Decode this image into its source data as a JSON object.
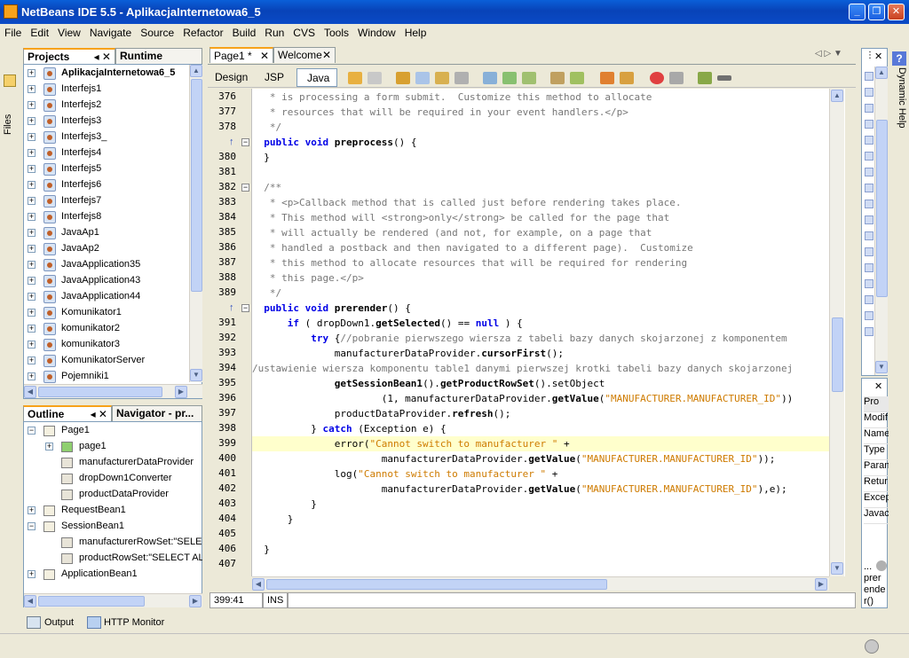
{
  "window": {
    "title": "NetBeans IDE 5.5 - AplikacjaInternetowa6_5"
  },
  "menu": [
    "File",
    "Edit",
    "View",
    "Navigate",
    "Source",
    "Refactor",
    "Build",
    "Run",
    "CVS",
    "Tools",
    "Window",
    "Help"
  ],
  "left_strip": {
    "files_label": "Files"
  },
  "projects_panel": {
    "tabs": [
      "Projects",
      "Runtime"
    ],
    "items": [
      "AplikacjaInternetowa6_5",
      "Interfejs1",
      "Interfejs2",
      "Interfejs3",
      "Interfejs3_",
      "Interfejs4",
      "Interfejs5",
      "Interfejs6",
      "Interfejs7",
      "Interfejs8",
      "JavaAp1",
      "JavaAp2",
      "JavaApplication35",
      "JavaApplication43",
      "JavaApplication44",
      "Komunikator1",
      "komunikator2",
      "komunikator3",
      "KomunikatorServer",
      "Pojemniki1"
    ]
  },
  "outline_panel": {
    "tabs": [
      "Outline",
      "Navigator - pr..."
    ],
    "items": [
      {
        "label": "Page1",
        "level": 0
      },
      {
        "label": "page1",
        "level": 1
      },
      {
        "label": "manufacturerDataProvider",
        "level": 1
      },
      {
        "label": "dropDown1Converter",
        "level": 1
      },
      {
        "label": "productDataProvider",
        "level": 1
      },
      {
        "label": "RequestBean1",
        "level": 0
      },
      {
        "label": "SessionBean1",
        "level": 0
      },
      {
        "label": "manufacturerRowSet:\"SELEC",
        "level": 1
      },
      {
        "label": "productRowSet:\"SELECT ALL",
        "level": 1
      },
      {
        "label": "ApplicationBean1",
        "level": 0
      }
    ]
  },
  "editor_tabs": [
    "Page1 *",
    "Welcome"
  ],
  "view_tabs": [
    "Design",
    "JSP",
    "Java"
  ],
  "code": {
    "lines": [
      {
        "n": "376",
        "t": "   * is processing a form submit.  Customize this method to allocate",
        "c": "cm"
      },
      {
        "n": "377",
        "t": "   * resources that will be required in your event handlers.</p>",
        "c": "cm"
      },
      {
        "n": "378",
        "t": "   */",
        "c": "cm"
      },
      {
        "n": "",
        "t": "  public void preprocess() {",
        "c": "pre"
      },
      {
        "n": "380",
        "t": "  }",
        "c": ""
      },
      {
        "n": "381",
        "t": "",
        "c": ""
      },
      {
        "n": "382",
        "t": "  /**",
        "c": "cm"
      },
      {
        "n": "383",
        "t": "   * <p>Callback method that is called just before rendering takes place.",
        "c": "cm"
      },
      {
        "n": "384",
        "t": "   * This method will <strong>only</strong> be called for the page that",
        "c": "cm"
      },
      {
        "n": "385",
        "t": "   * will actually be rendered (and not, for example, on a page that",
        "c": "cm"
      },
      {
        "n": "386",
        "t": "   * handled a postback and then navigated to a different page).  Customize",
        "c": "cm"
      },
      {
        "n": "387",
        "t": "   * this method to allocate resources that will be required for rendering",
        "c": "cm"
      },
      {
        "n": "388",
        "t": "   * this page.</p>",
        "c": "cm"
      },
      {
        "n": "389",
        "t": "   */",
        "c": "cm"
      },
      {
        "n": "",
        "t": "  public void prerender() {",
        "c": "prer"
      },
      {
        "n": "391",
        "t": "      if ( dropDown1.getSelected() == null ) {",
        "c": "if"
      },
      {
        "n": "392",
        "t": "          try {//pobranie pierwszego wiersza z tabeli bazy danych skojarzonej z komponentem",
        "c": "try"
      },
      {
        "n": "393",
        "t": "              manufacturerDataProvider.cursorFirst();",
        "c": "cf"
      },
      {
        "n": "394",
        "t": "/ustawienie wiersza komponentu table1 danymi pierwszej krotki tabeli bazy danych skojarzonej",
        "c": "cm2"
      },
      {
        "n": "395",
        "t": "              getSessionBean1().getProductRowSet().setObject",
        "c": "gs"
      },
      {
        "n": "396",
        "t": "                      (1, manufacturerDataProvider.getValue(\"MANUFACTURER.MANUFACTURER_ID\"))",
        "c": "gv"
      },
      {
        "n": "397",
        "t": "              productDataProvider.refresh();",
        "c": "rf"
      },
      {
        "n": "398",
        "t": "          } catch (Exception e) {",
        "c": "catch"
      },
      {
        "n": "399",
        "t": "              error(\"Cannot switch to manufacturer \" +",
        "c": "err"
      },
      {
        "n": "400",
        "t": "                      manufacturerDataProvider.getValue(\"MANUFACTURER.MANUFACTURER_ID\"));",
        "c": "gv2"
      },
      {
        "n": "401",
        "t": "              log(\"Cannot switch to manufacturer \" +",
        "c": "log"
      },
      {
        "n": "402",
        "t": "                      manufacturerDataProvider.getValue(\"MANUFACTURER.MANUFACTURER_ID\"),e);",
        "c": "gv3"
      },
      {
        "n": "403",
        "t": "          }",
        "c": ""
      },
      {
        "n": "404",
        "t": "      }",
        "c": ""
      },
      {
        "n": "405",
        "t": "",
        "c": ""
      },
      {
        "n": "406",
        "t": "  }",
        "c": ""
      },
      {
        "n": "407",
        "t": "",
        "c": ""
      }
    ]
  },
  "status": {
    "position": "399:41",
    "mode": "INS"
  },
  "right_panel": {
    "dynamic_help": "Dynamic Help",
    "props": [
      "Pro",
      "Modif",
      "Name",
      "Type",
      "Paran",
      "Retur",
      "Excep",
      "Javac"
    ],
    "bottom": [
      "...",
      "prer",
      "ende",
      "r()"
    ]
  },
  "bottom_tabs": [
    "Output",
    "HTTP Monitor"
  ]
}
